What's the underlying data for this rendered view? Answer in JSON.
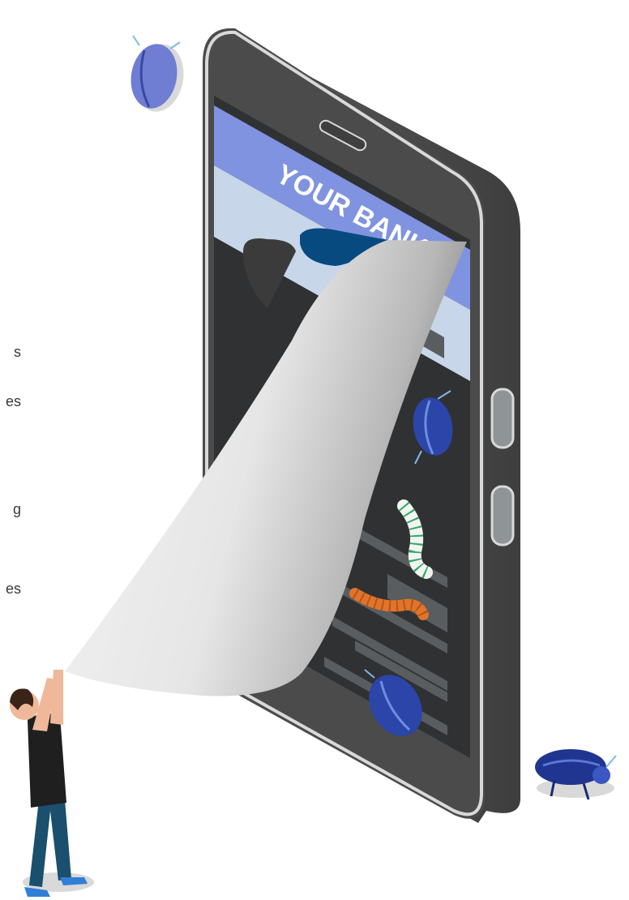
{
  "illustration": {
    "bank_label": "YOUR BANK",
    "cropped_text_fragments": [
      "s",
      "es",
      "g",
      "es"
    ]
  },
  "colors": {
    "phone_body": "#4b4b4b",
    "phone_rim": "#d9d9d9",
    "screen_dark": "#2f3133",
    "bank_header": "#8093e0",
    "bank_panel": "#c8d6ea",
    "peel_sheet": "#eeeeee",
    "bug_blue": "#2b45a8",
    "bug_purple": "#6f7ed2",
    "worm_orange": "#e0742a",
    "worm_white": "#f2f4ef",
    "worm_stripe": "#2fa864"
  }
}
